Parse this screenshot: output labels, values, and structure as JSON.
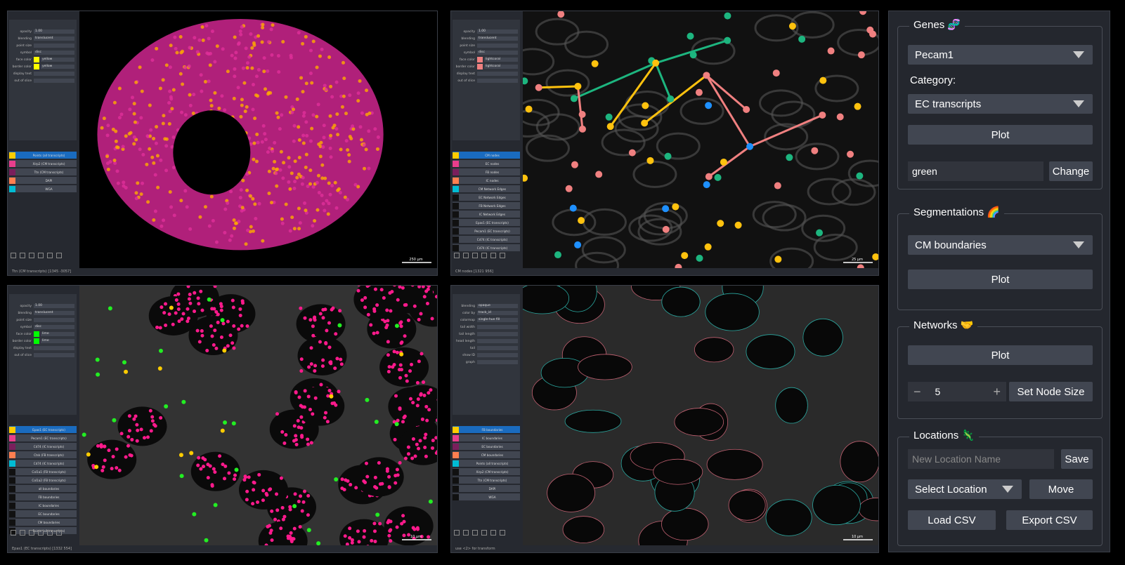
{
  "views": [
    {
      "status": "Ttn (CM transcripts)  [1345 -3057]",
      "scale": "250 µm",
      "controls": [
        {
          "l": "opacity",
          "v": "1.00"
        },
        {
          "l": "blending",
          "v": "translucent"
        },
        {
          "l": "point size",
          "v": ""
        },
        {
          "l": "symbol",
          "v": "disc"
        },
        {
          "l": "face color",
          "v": "yellow"
        },
        {
          "l": "border color",
          "v": "yellow"
        },
        {
          "l": "display text",
          "v": ""
        },
        {
          "l": "out of slice",
          "v": ""
        }
      ],
      "layers": [
        "Points (all transcripts)",
        "Xirp2 (CM transcripts)",
        "Ttn (CM transcripts)",
        "DAPI",
        "WGA"
      ],
      "sel": 0
    },
    {
      "status": "CM nodes  [1321 956]",
      "scale": "25 µm",
      "controls": [
        {
          "l": "opacity",
          "v": "1.00"
        },
        {
          "l": "blending",
          "v": "translucent"
        },
        {
          "l": "point size",
          "v": ""
        },
        {
          "l": "symbol",
          "v": "disc"
        },
        {
          "l": "face color",
          "v": "lightcoral"
        },
        {
          "l": "border color",
          "v": "lightcoral"
        },
        {
          "l": "display text",
          "v": ""
        },
        {
          "l": "out of slice",
          "v": ""
        }
      ],
      "layers": [
        "CM nodes",
        "EC nodes",
        "FB nodes",
        "IC nodes",
        "CM Network Edges",
        "EC Network Edges",
        "FB Network Edges",
        "IC Network Edges",
        "Epas1 (EC transcripts)",
        "Pecam1 (EC transcripts)",
        "Cd74 (IC transcripts)",
        "Cd74 (IC transcripts)"
      ],
      "sel": 0
    },
    {
      "status": "Epas1 (EC transcripts)  [1332 554]",
      "scale": "10 µm",
      "controls": [
        {
          "l": "opacity",
          "v": "1.00"
        },
        {
          "l": "blending",
          "v": "translucent"
        },
        {
          "l": "point size",
          "v": ""
        },
        {
          "l": "symbol",
          "v": "disc"
        },
        {
          "l": "face color",
          "v": "lime"
        },
        {
          "l": "border color",
          "v": "lime"
        },
        {
          "l": "display text",
          "v": ""
        },
        {
          "l": "out of slice",
          "v": ""
        }
      ],
      "layers": [
        "Epas1 (EC transcripts)",
        "Pecam1 (EC transcripts)",
        "Cd74 (IC transcripts)",
        "Ctsk (FB transcripts)",
        "Cd74 (IC transcripts)",
        "Col1a1 (FB transcripts)",
        "Col1a2 (FB transcripts)",
        "all boundaries",
        "FB boundaries",
        "IC boundaries",
        "EC boundaries",
        "CM boundaries",
        "Points (all transcripts)"
      ],
      "sel": 0
    },
    {
      "status": "use <2> for transform",
      "scale": "10 µm",
      "controls": [
        {
          "l": "blending",
          "v": "opaque"
        },
        {
          "l": "color by",
          "v": "track_id"
        },
        {
          "l": "colormap",
          "v": "single-hue fill"
        },
        {
          "l": "tail width",
          "v": ""
        },
        {
          "l": "tail length",
          "v": ""
        },
        {
          "l": "head length",
          "v": ""
        },
        {
          "l": "tail",
          "v": ""
        },
        {
          "l": "show ID",
          "v": ""
        },
        {
          "l": "graph",
          "v": ""
        }
      ],
      "layers": [
        "FB boundaries",
        "IC boundaries",
        "EC boundaries",
        "CM boundaries",
        "Points (all transcripts)",
        "Xirp2 (CM transcripts)",
        "Ttn (CM transcripts)",
        "DAPI",
        "WGA"
      ],
      "sel": 0
    }
  ],
  "panel": {
    "genes": {
      "title": "Genes 🧬",
      "gene": "Pecam1",
      "category_label": "Category:",
      "category": "EC transcripts",
      "plot": "Plot",
      "color": "green",
      "change": "Change"
    },
    "seg": {
      "title": "Segmentations 🌈",
      "value": "CM boundaries",
      "plot": "Plot"
    },
    "net": {
      "title": "Networks 🤝",
      "plot": "Plot",
      "minus": "−",
      "size": "5",
      "plus": "+",
      "set": "Set Node Size"
    },
    "loc": {
      "title": "Locations 🦎",
      "placeholder": "New Location Name",
      "save": "Save",
      "select": "Select Location",
      "move": "Move",
      "load": "Load CSV",
      "export": "Export CSV"
    }
  },
  "colors": {
    "pink": "#f08080",
    "green": "#1db57f",
    "yellow": "#ffc20e",
    "blue": "#1e90ff",
    "magenta": "#ff1a8c"
  }
}
